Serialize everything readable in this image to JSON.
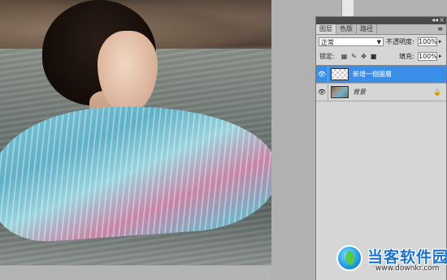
{
  "panel": {
    "tabs": [
      {
        "label": "图层",
        "active": true
      },
      {
        "label": "色版",
        "active": false
      },
      {
        "label": "路径",
        "active": false
      }
    ],
    "collapse_glyph": "◂◂",
    "close_glyph": "×",
    "menu_glyph": "≡",
    "blend_mode": "正常",
    "opacity_label": "不透明度:",
    "opacity_value": "100%",
    "lock_label": "锁定:",
    "fill_label": "填充:",
    "fill_value": "100%",
    "layers": [
      {
        "name": "新增一個圖層",
        "selected": true,
        "thumbnail": "transparent",
        "visible": true
      },
      {
        "name": "背景",
        "selected": false,
        "thumbnail": "photo",
        "visible": true,
        "locked": true
      }
    ]
  },
  "icons": {
    "eye": "eye-icon",
    "lock": "lock-icon",
    "dropdown": "chevron-down-icon"
  },
  "colors": {
    "selection": "#3b8ee8",
    "panel_bg": "#d6d6d6",
    "workspace": "#b4b4b4"
  },
  "watermark": {
    "title": "当客软件园",
    "url": "www.downkr.com"
  }
}
